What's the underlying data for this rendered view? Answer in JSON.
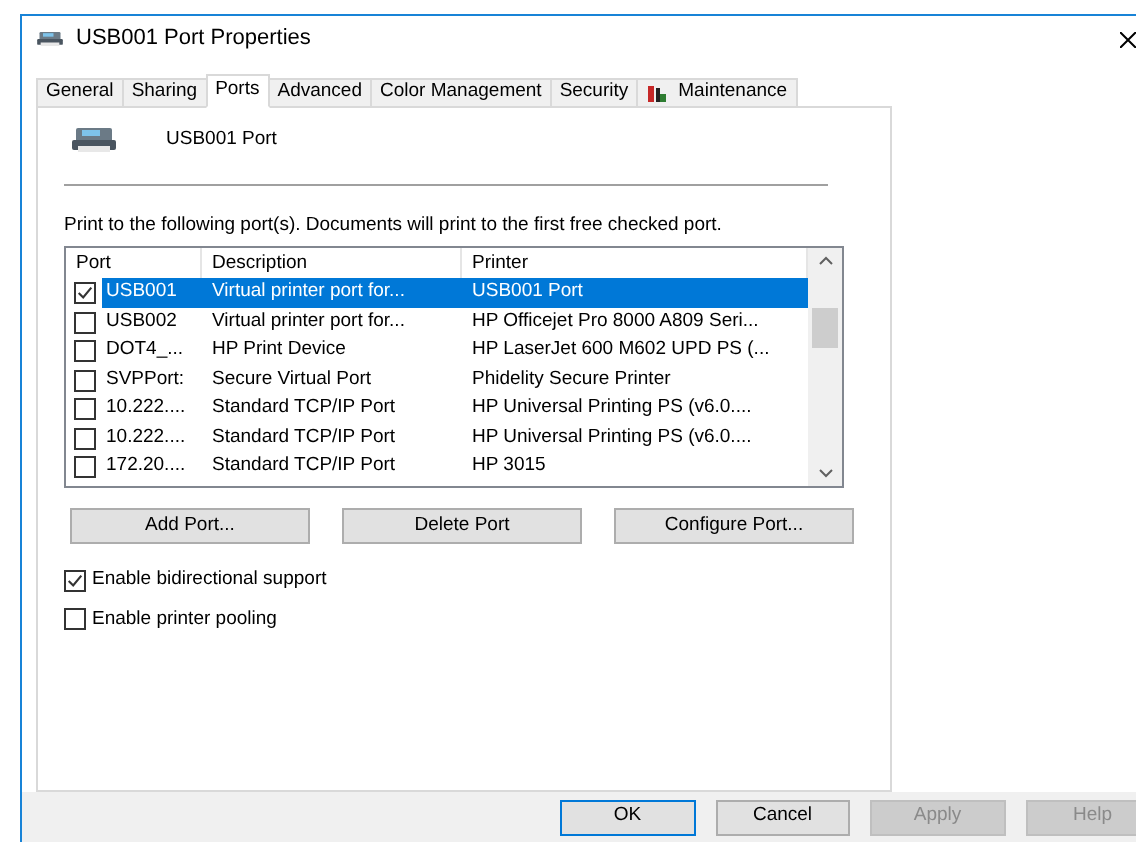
{
  "window": {
    "title": "USB001 Port Properties"
  },
  "tabs": [
    {
      "label": "General",
      "selected": false
    },
    {
      "label": "Sharing",
      "selected": false
    },
    {
      "label": "Ports",
      "selected": true
    },
    {
      "label": "Advanced",
      "selected": false
    },
    {
      "label": "Color Management",
      "selected": false
    },
    {
      "label": "Security",
      "selected": false
    },
    {
      "label": "Maintenance",
      "selected": false,
      "kind": "icon"
    }
  ],
  "printer_name": "USB001 Port",
  "instructions": "Print to the following port(s). Documents will print to the first free checked port.",
  "ports_table": {
    "columns": [
      "Port",
      "Description",
      "Printer"
    ],
    "rows": [
      {
        "port": "USB001",
        "description": "Virtual printer port for...",
        "printer": "USB001 Port",
        "checked": true,
        "selected": true
      },
      {
        "port": "USB002",
        "description": "Virtual printer port for...",
        "printer": "HP Officejet Pro 8000 A809 Seri...",
        "checked": false,
        "selected": false
      },
      {
        "port": "DOT4_...",
        "description": "HP Print Device",
        "printer": "HP LaserJet 600 M602 UPD PS (...",
        "checked": false,
        "selected": false
      },
      {
        "port": "SVPPort:",
        "description": "Secure Virtual Port",
        "printer": "Phidelity Secure Printer",
        "checked": false,
        "selected": false
      },
      {
        "port": "10.222....",
        "description": "Standard TCP/IP Port",
        "printer": "HP Universal Printing PS (v6.0....",
        "checked": false,
        "selected": false
      },
      {
        "port": "10.222....",
        "description": "Standard TCP/IP Port",
        "printer": "HP Universal Printing PS (v6.0....",
        "checked": false,
        "selected": false
      },
      {
        "port": "172.20....",
        "description": "Standard TCP/IP Port",
        "printer": "HP 3015",
        "checked": false,
        "selected": false
      }
    ]
  },
  "port_buttons": [
    "Add Port...",
    "Delete Port",
    "Configure Port..."
  ],
  "options": [
    {
      "label": "Enable bidirectional support",
      "checked": true
    },
    {
      "label": "Enable printer pooling",
      "checked": false
    }
  ],
  "dialog_buttons": [
    {
      "label": "OK",
      "disabled": false,
      "default": true
    },
    {
      "label": "Cancel",
      "disabled": false,
      "default": false
    },
    {
      "label": "Apply",
      "disabled": true,
      "default": false
    },
    {
      "label": "Help",
      "disabled": true,
      "default": false
    }
  ]
}
